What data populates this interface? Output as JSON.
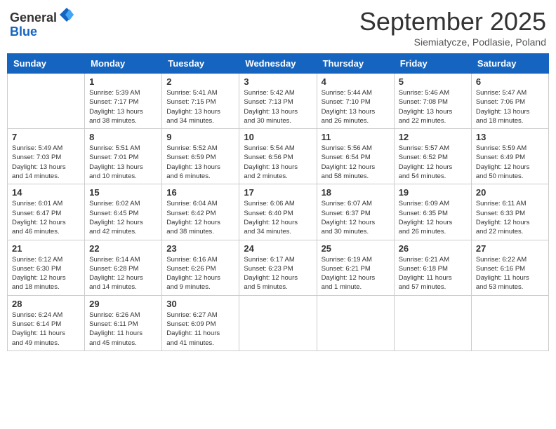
{
  "logo": {
    "general": "General",
    "blue": "Blue"
  },
  "header": {
    "title": "September 2025",
    "subtitle": "Siemiatycze, Podlasie, Poland"
  },
  "weekdays": [
    "Sunday",
    "Monday",
    "Tuesday",
    "Wednesday",
    "Thursday",
    "Friday",
    "Saturday"
  ],
  "weeks": [
    [
      {
        "day": "",
        "info": ""
      },
      {
        "day": "1",
        "info": "Sunrise: 5:39 AM\nSunset: 7:17 PM\nDaylight: 13 hours\nand 38 minutes."
      },
      {
        "day": "2",
        "info": "Sunrise: 5:41 AM\nSunset: 7:15 PM\nDaylight: 13 hours\nand 34 minutes."
      },
      {
        "day": "3",
        "info": "Sunrise: 5:42 AM\nSunset: 7:13 PM\nDaylight: 13 hours\nand 30 minutes."
      },
      {
        "day": "4",
        "info": "Sunrise: 5:44 AM\nSunset: 7:10 PM\nDaylight: 13 hours\nand 26 minutes."
      },
      {
        "day": "5",
        "info": "Sunrise: 5:46 AM\nSunset: 7:08 PM\nDaylight: 13 hours\nand 22 minutes."
      },
      {
        "day": "6",
        "info": "Sunrise: 5:47 AM\nSunset: 7:06 PM\nDaylight: 13 hours\nand 18 minutes."
      }
    ],
    [
      {
        "day": "7",
        "info": "Sunrise: 5:49 AM\nSunset: 7:03 PM\nDaylight: 13 hours\nand 14 minutes."
      },
      {
        "day": "8",
        "info": "Sunrise: 5:51 AM\nSunset: 7:01 PM\nDaylight: 13 hours\nand 10 minutes."
      },
      {
        "day": "9",
        "info": "Sunrise: 5:52 AM\nSunset: 6:59 PM\nDaylight: 13 hours\nand 6 minutes."
      },
      {
        "day": "10",
        "info": "Sunrise: 5:54 AM\nSunset: 6:56 PM\nDaylight: 13 hours\nand 2 minutes."
      },
      {
        "day": "11",
        "info": "Sunrise: 5:56 AM\nSunset: 6:54 PM\nDaylight: 12 hours\nand 58 minutes."
      },
      {
        "day": "12",
        "info": "Sunrise: 5:57 AM\nSunset: 6:52 PM\nDaylight: 12 hours\nand 54 minutes."
      },
      {
        "day": "13",
        "info": "Sunrise: 5:59 AM\nSunset: 6:49 PM\nDaylight: 12 hours\nand 50 minutes."
      }
    ],
    [
      {
        "day": "14",
        "info": "Sunrise: 6:01 AM\nSunset: 6:47 PM\nDaylight: 12 hours\nand 46 minutes."
      },
      {
        "day": "15",
        "info": "Sunrise: 6:02 AM\nSunset: 6:45 PM\nDaylight: 12 hours\nand 42 minutes."
      },
      {
        "day": "16",
        "info": "Sunrise: 6:04 AM\nSunset: 6:42 PM\nDaylight: 12 hours\nand 38 minutes."
      },
      {
        "day": "17",
        "info": "Sunrise: 6:06 AM\nSunset: 6:40 PM\nDaylight: 12 hours\nand 34 minutes."
      },
      {
        "day": "18",
        "info": "Sunrise: 6:07 AM\nSunset: 6:37 PM\nDaylight: 12 hours\nand 30 minutes."
      },
      {
        "day": "19",
        "info": "Sunrise: 6:09 AM\nSunset: 6:35 PM\nDaylight: 12 hours\nand 26 minutes."
      },
      {
        "day": "20",
        "info": "Sunrise: 6:11 AM\nSunset: 6:33 PM\nDaylight: 12 hours\nand 22 minutes."
      }
    ],
    [
      {
        "day": "21",
        "info": "Sunrise: 6:12 AM\nSunset: 6:30 PM\nDaylight: 12 hours\nand 18 minutes."
      },
      {
        "day": "22",
        "info": "Sunrise: 6:14 AM\nSunset: 6:28 PM\nDaylight: 12 hours\nand 14 minutes."
      },
      {
        "day": "23",
        "info": "Sunrise: 6:16 AM\nSunset: 6:26 PM\nDaylight: 12 hours\nand 9 minutes."
      },
      {
        "day": "24",
        "info": "Sunrise: 6:17 AM\nSunset: 6:23 PM\nDaylight: 12 hours\nand 5 minutes."
      },
      {
        "day": "25",
        "info": "Sunrise: 6:19 AM\nSunset: 6:21 PM\nDaylight: 12 hours\nand 1 minute."
      },
      {
        "day": "26",
        "info": "Sunrise: 6:21 AM\nSunset: 6:18 PM\nDaylight: 11 hours\nand 57 minutes."
      },
      {
        "day": "27",
        "info": "Sunrise: 6:22 AM\nSunset: 6:16 PM\nDaylight: 11 hours\nand 53 minutes."
      }
    ],
    [
      {
        "day": "28",
        "info": "Sunrise: 6:24 AM\nSunset: 6:14 PM\nDaylight: 11 hours\nand 49 minutes."
      },
      {
        "day": "29",
        "info": "Sunrise: 6:26 AM\nSunset: 6:11 PM\nDaylight: 11 hours\nand 45 minutes."
      },
      {
        "day": "30",
        "info": "Sunrise: 6:27 AM\nSunset: 6:09 PM\nDaylight: 11 hours\nand 41 minutes."
      },
      {
        "day": "",
        "info": ""
      },
      {
        "day": "",
        "info": ""
      },
      {
        "day": "",
        "info": ""
      },
      {
        "day": "",
        "info": ""
      }
    ]
  ]
}
